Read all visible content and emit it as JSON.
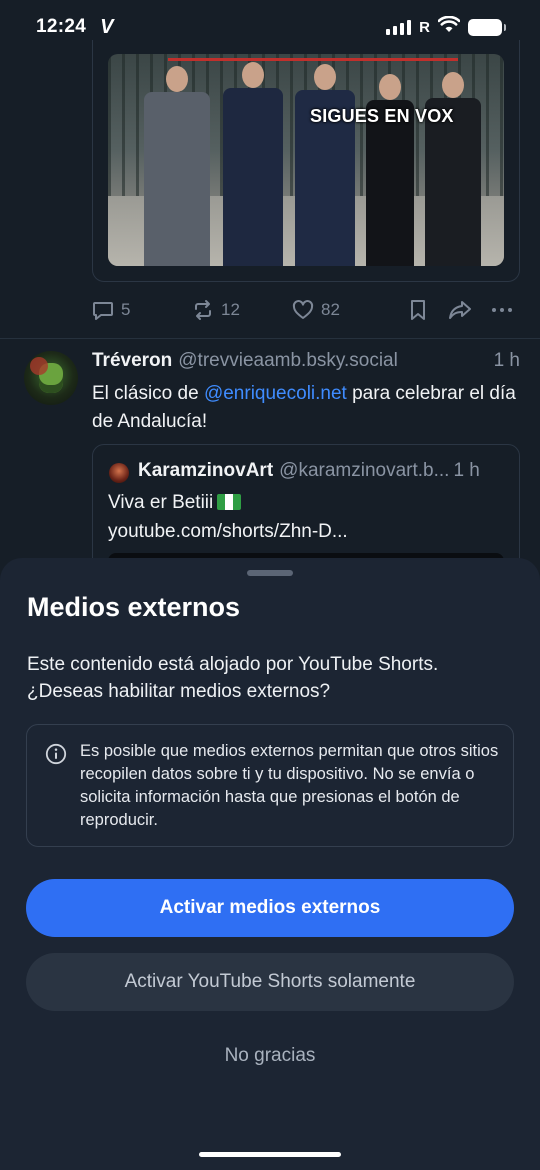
{
  "status_bar": {
    "time": "12:24",
    "carrier": "R"
  },
  "post_above": {
    "image_caption": "SIGUES EN VOX",
    "actions": {
      "replies": "5",
      "reposts": "12",
      "likes": "82"
    }
  },
  "post": {
    "author_name": "Tréveron",
    "author_handle": "@trevvieaamb.bsky.social",
    "time": "1 h",
    "text_before": "El clásico de ",
    "mention": "@enriquecoli.net",
    "text_after": " para celebrar el día de Andalucía!",
    "quote": {
      "author_name": "KaramzinovArt",
      "author_handle": "@karamzinovart.b...",
      "time": "1 h",
      "line1": "Viva er Betiii",
      "line2": "youtube.com/shorts/Zhn-D..."
    }
  },
  "sheet": {
    "title": "Medios externos",
    "description": "Este contenido está alojado por YouTube Shorts. ¿Deseas habilitar medios externos?",
    "info": "Es posible que medios externos permitan que otros sitios recopilen datos sobre ti y tu dispositivo. No se envía o solicita información hasta que presionas el botón de reproducir.",
    "primary_button": "Activar medios externos",
    "secondary_button": "Activar YouTube Shorts solamente",
    "tertiary_button": "No gracias"
  },
  "colors": {
    "background": "#161e27",
    "sheet": "#1c2533",
    "accent": "#2f6ff3",
    "mention": "#3f8cff"
  },
  "icons": [
    "app-logo-icon",
    "signal-icon",
    "wifi-icon",
    "battery-icon",
    "reply-icon",
    "repost-icon",
    "like-icon",
    "bookmark-icon",
    "share-icon",
    "more-icon",
    "info-icon",
    "flag-icon"
  ]
}
